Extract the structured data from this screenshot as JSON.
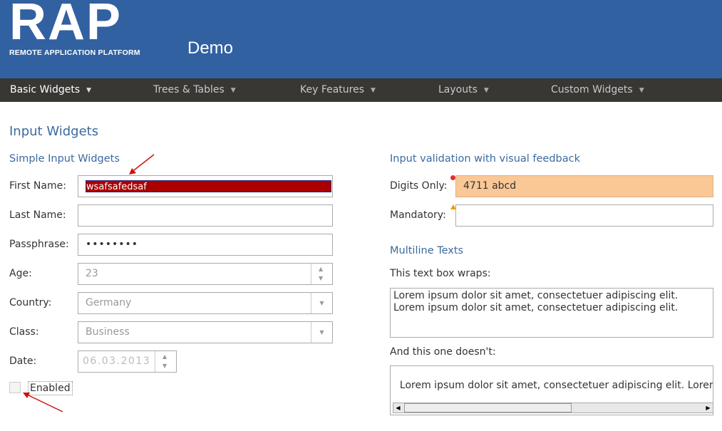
{
  "header": {
    "logo": "RAP",
    "logo_sub": "REMOTE APPLICATION PLATFORM",
    "app_title": "Demo"
  },
  "nav": {
    "items": [
      {
        "label": "Basic Widgets",
        "active": true
      },
      {
        "label": "Trees & Tables",
        "active": false
      },
      {
        "label": "Key Features",
        "active": false
      },
      {
        "label": "Layouts",
        "active": false
      },
      {
        "label": "Custom Widgets",
        "active": false
      }
    ],
    "caret": "▼"
  },
  "page": {
    "title": "Input Widgets"
  },
  "simple": {
    "heading": "Simple Input Widgets",
    "first_name": {
      "label": "First Name:",
      "value": "wsafsafedsaf"
    },
    "last_name": {
      "label": "Last Name:",
      "value": ""
    },
    "passphrase": {
      "label": "Passphrase:",
      "value": "••••••••"
    },
    "age": {
      "label": "Age:",
      "value": "23"
    },
    "country": {
      "label": "Country:",
      "value": "Germany"
    },
    "class": {
      "label": "Class:",
      "value": "Business"
    },
    "date": {
      "label": "Date:",
      "value": "06.03.2013"
    },
    "enabled": {
      "label": "Enabled",
      "checked": false
    }
  },
  "validation": {
    "heading": "Input validation with visual feedback",
    "digits": {
      "label": "Digits Only:",
      "value": "4711 abcd"
    },
    "mandatory": {
      "label": "Mandatory:",
      "value": ""
    }
  },
  "multiline": {
    "heading": "Multiline Texts",
    "wrap_label": "This text box wraps:",
    "wrap_text": "Lorem ipsum dolor sit amet, consectetuer adipiscing elit.\nLorem ipsum dolor sit amet, consectetuer adipiscing elit.",
    "nowrap_label": "And this one doesn't:",
    "nowrap_text": "Lorem ipsum dolor sit amet, consectetuer adipiscing elit. Lorem"
  },
  "colors": {
    "header_bg": "#3161a1",
    "nav_bg": "#383734",
    "heading": "#3b6aa0",
    "error_bg": "#fac896",
    "selection": "#aa0000",
    "annotation_arrow": "#d01010"
  }
}
